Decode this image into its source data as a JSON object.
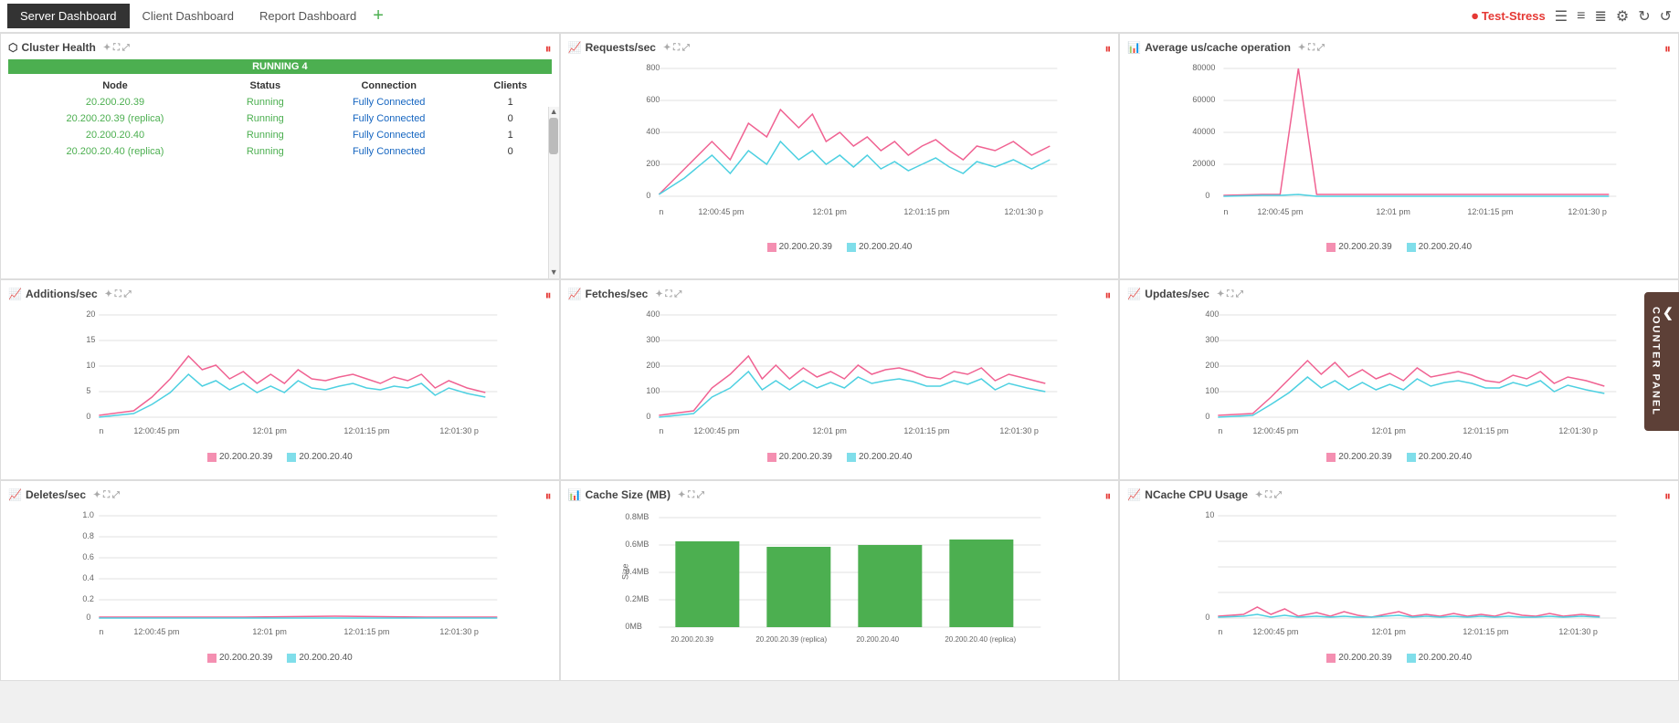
{
  "topnav": {
    "tabs": [
      {
        "label": "Server Dashboard",
        "active": true
      },
      {
        "label": "Client Dashboard",
        "active": false
      },
      {
        "label": "Report Dashboard",
        "active": false
      }
    ],
    "add_label": "+",
    "stress_name": "Test-Stress"
  },
  "cluster": {
    "title": "Cluster Health",
    "running_label": "RUNNING 4",
    "columns": [
      "Node",
      "Status",
      "Connection",
      "Clients"
    ],
    "rows": [
      {
        "node": "20.200.20.39",
        "status": "Running",
        "connection": "Fully Connected",
        "clients": "1"
      },
      {
        "node": "20.200.20.39 (replica)",
        "status": "Running",
        "connection": "Fully Connected",
        "clients": "0"
      },
      {
        "node": "20.200.20.40",
        "status": "Running",
        "connection": "Fully Connected",
        "clients": "1"
      },
      {
        "node": "20.200.20.40 (replica)",
        "status": "Running",
        "connection": "Fully Connected",
        "clients": "0"
      }
    ]
  },
  "panels": {
    "requests": {
      "title": "Requests/sec"
    },
    "avg_cache": {
      "title": "Average us/cache operation"
    },
    "additions": {
      "title": "Additions/sec"
    },
    "fetches": {
      "title": "Fetches/sec"
    },
    "updates": {
      "title": "Updates/sec"
    },
    "deletes": {
      "title": "Deletes/sec"
    },
    "cache_size": {
      "title": "Cache Size (MB)"
    },
    "ncache_cpu": {
      "title": "NCache CPU Usage"
    }
  },
  "legend": {
    "node1": "20.200.20.39",
    "node2": "20.200.20.40"
  },
  "xaxis": {
    "labels": [
      "n",
      "12:00:45 pm",
      "12:01 pm",
      "12:01:15 pm",
      "12:01:30 p"
    ]
  },
  "counter_panel": "COUNTER PANEL"
}
